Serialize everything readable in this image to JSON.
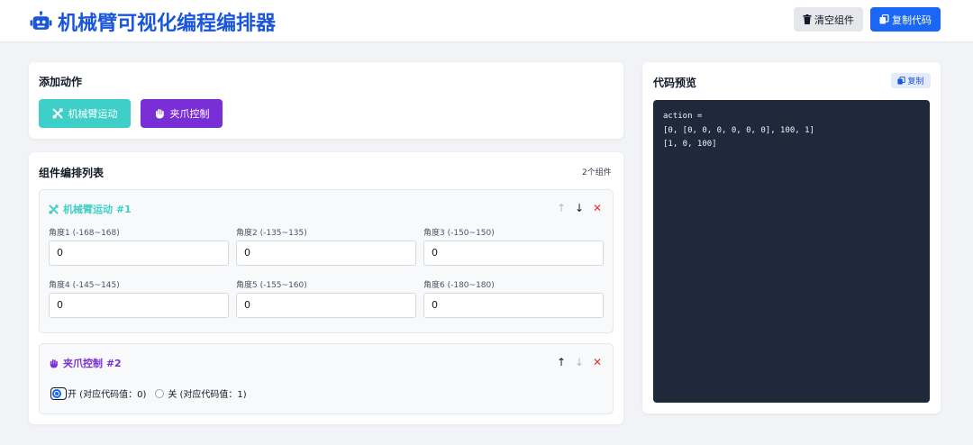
{
  "header": {
    "title": "机械臂可视化编程编排器",
    "clear_label": "清空组件",
    "copy_code_label": "复制代码",
    "logo_icon": "robot-icon",
    "colors": {
      "brand": "#1a56db",
      "primary_button": "#1a66f5"
    }
  },
  "add_panel": {
    "title": "添加动作",
    "buttons": [
      {
        "label": "机械臂运动",
        "icon": "tools-icon",
        "color": "#3ecfc8"
      },
      {
        "label": "夹爪控制",
        "icon": "hand-icon",
        "color": "#7a2fd6"
      }
    ]
  },
  "list_panel": {
    "title": "组件编排列表",
    "count": "2个组件",
    "components": [
      {
        "title": "机械臂运动 #1",
        "icon": "tools-icon",
        "fields": [
          {
            "label": "角度1 (-168~168)",
            "value": "0"
          },
          {
            "label": "角度2 (-135~135)",
            "value": "0"
          },
          {
            "label": "角度3 (-150~150)",
            "value": "0"
          },
          {
            "label": "角度4 (-145~145)",
            "value": "0"
          },
          {
            "label": "角度5 (-155~160)",
            "value": "0"
          },
          {
            "label": "角度6 (-180~180)",
            "value": "0"
          }
        ],
        "actions": {
          "up": "↑",
          "down": "↓",
          "delete": "✕"
        }
      },
      {
        "title": "夹爪控制 #2",
        "icon": "hand-icon",
        "options": [
          {
            "label": "开 (对应代码值：0)",
            "checked": true
          },
          {
            "label": "关 (对应代码值：1)",
            "checked": false
          }
        ],
        "actions": {
          "up": "↑",
          "down": "↓",
          "delete": "✕"
        }
      }
    ]
  },
  "preview_panel": {
    "title": "代码预览",
    "copy_label": "复制",
    "code_lines": [
      "action =",
      "[0, [0, 0, 0, 0, 0, 0], 100, 1]",
      "[1, 0, 100]"
    ]
  }
}
